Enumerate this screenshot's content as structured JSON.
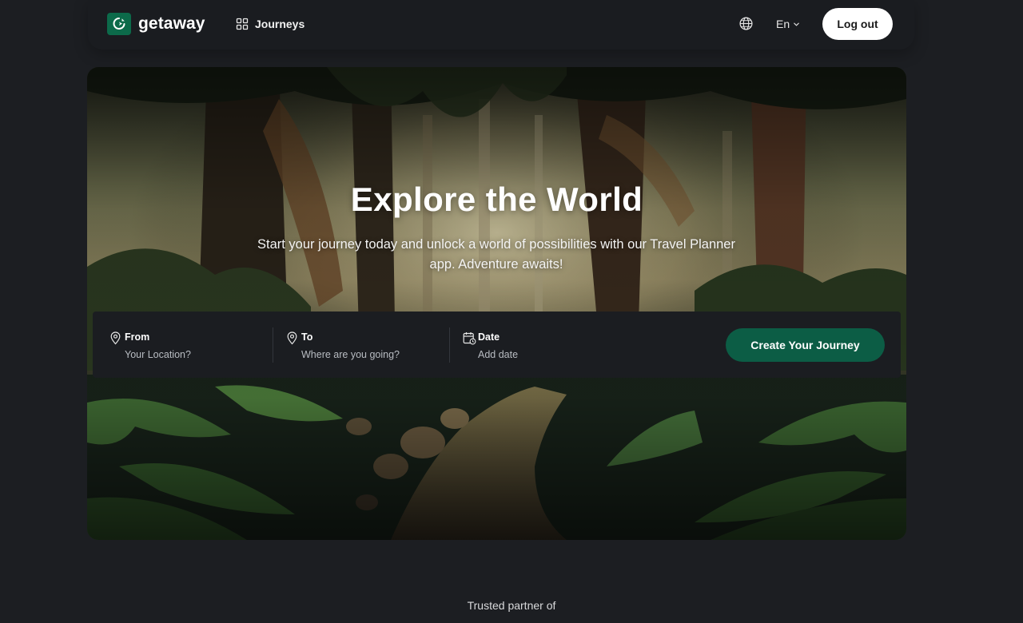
{
  "header": {
    "brand_name": "getaway",
    "nav_journeys": "Journeys",
    "language": "En",
    "logout_label": "Log out"
  },
  "hero": {
    "title": "Explore the World",
    "subtitle": "Start your journey today and unlock a world of possibilities with our Travel Planner app. Adventure awaits!"
  },
  "search": {
    "from_label": "From",
    "from_placeholder": "Your Location?",
    "to_label": "To",
    "to_placeholder": "Where are you going?",
    "date_label": "Date",
    "date_placeholder": "Add date",
    "cta_label": "Create Your Journey"
  },
  "trusted_caption": "Trusted partner of",
  "icons": {
    "brand": "location-pin-logo-icon",
    "journeys": "grid-icon",
    "language": "globe-icon",
    "from": "map-pin-icon",
    "to": "map-pin-icon",
    "date": "calendar-clock-icon"
  },
  "colors": {
    "page_bg": "#1c1e22",
    "brand_green": "#0c6a4a",
    "cta_green": "#0c5d45",
    "button_light": "#ffffff"
  }
}
